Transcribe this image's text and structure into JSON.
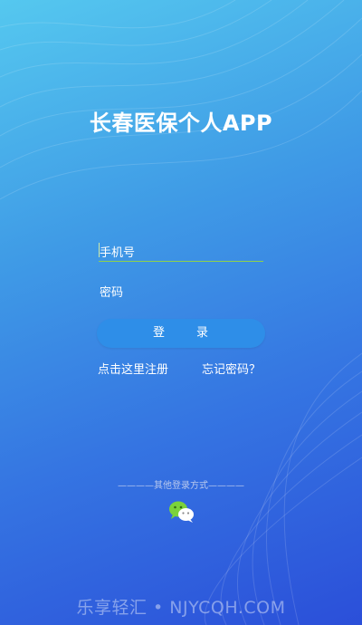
{
  "app": {
    "title": "长春医保个人APP"
  },
  "form": {
    "phone_placeholder": "手机号",
    "password_placeholder": "密码",
    "login_chars": [
      "登",
      "录"
    ]
  },
  "links": {
    "register": "点击这里注册",
    "forgot": "忘记密码？"
  },
  "other_login": {
    "label": "————其他登录方式————",
    "icon": "wechat-icon"
  },
  "watermark": {
    "text": "乐享轻汇 • NJYCQH.COM"
  },
  "colors": {
    "bg_top": "#55c8ef",
    "bg_bottom": "#2b4fd9",
    "button": "#2e8ee8",
    "input_underline": "#8fd24a",
    "wechat_green": "#7bd23b"
  }
}
